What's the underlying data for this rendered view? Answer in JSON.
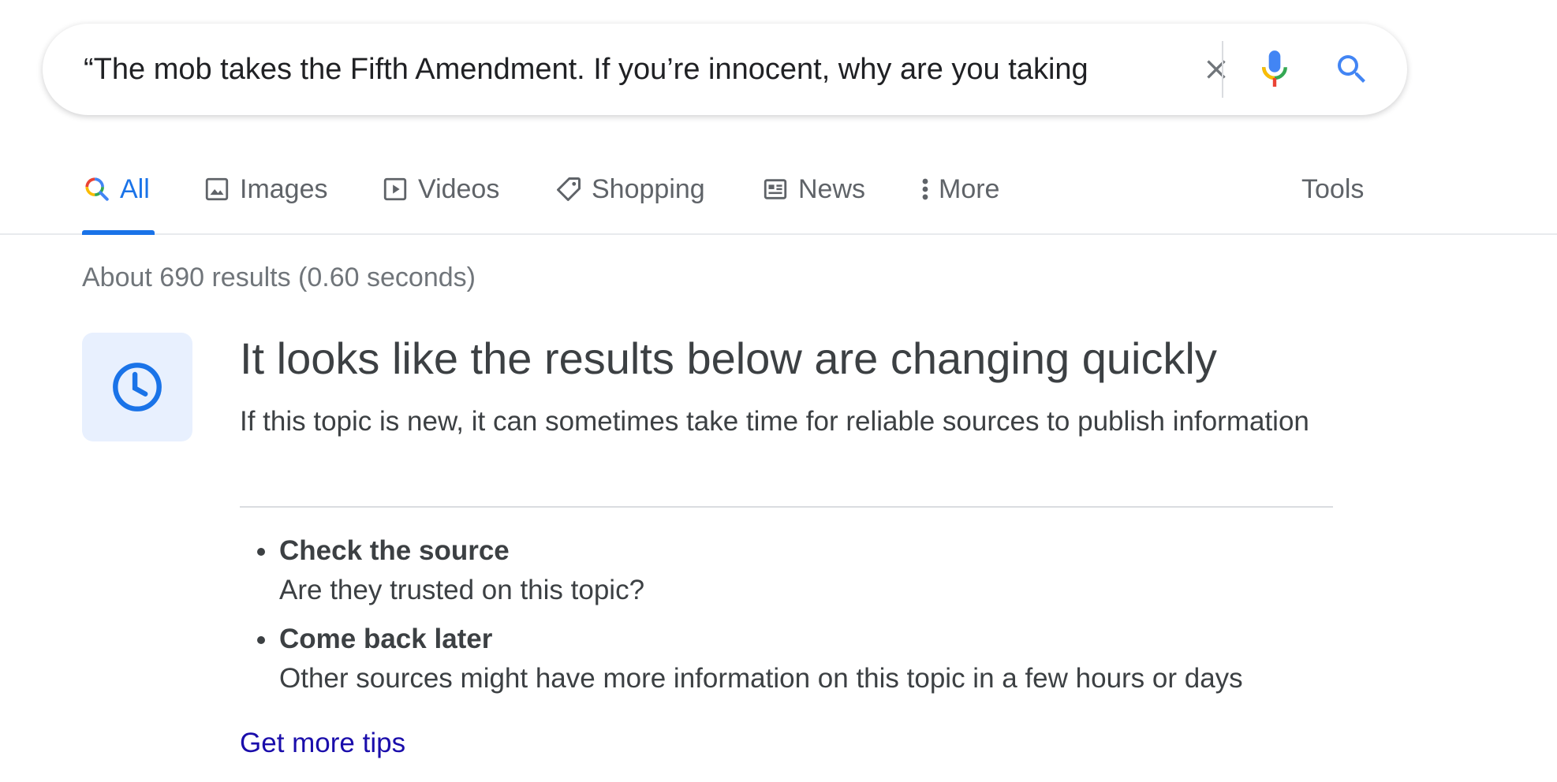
{
  "search": {
    "query": "“The mob takes the Fifth Amendment. If you’re innocent, why are you taking",
    "clear_icon": "close-icon",
    "mic_icon": "microphone-icon",
    "search_icon": "search-icon"
  },
  "tabs": [
    {
      "label": "All",
      "icon": "search-multicolor-icon",
      "active": true
    },
    {
      "label": "Images",
      "icon": "image-icon"
    },
    {
      "label": "Videos",
      "icon": "play-icon"
    },
    {
      "label": "Shopping",
      "icon": "tag-icon"
    },
    {
      "label": "News",
      "icon": "newspaper-icon"
    },
    {
      "label": "More",
      "icon": "more-vert-icon"
    }
  ],
  "tools_label": "Tools",
  "stats": "About 690 results (0.60 seconds)",
  "notice": {
    "icon": "clock-icon",
    "title": "It looks like the results below are changing quickly",
    "description": "If this topic is new, it can sometimes take time for reliable sources to publish information",
    "tips": [
      {
        "title": "Check the source",
        "description": "Are they trusted on this topic?"
      },
      {
        "title": "Come back later",
        "description": "Other sources might have more information on this topic in a few hours or days"
      }
    ],
    "more_tips_link": "Get more tips"
  },
  "colors": {
    "accent": "#1a73e8",
    "link": "#1a0dab",
    "notice_bg": "#e8f0fe"
  }
}
